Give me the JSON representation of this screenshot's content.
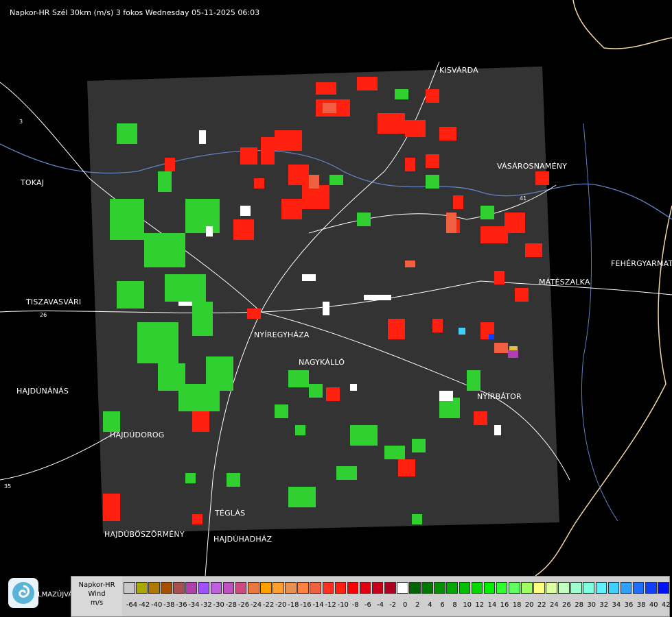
{
  "header": {
    "title": "Napkor-HR Szél 30km (m/s) 3 fokos Wednesday 05-11-2025 06:03"
  },
  "cities": [
    {
      "name": "KISVÁRDA"
    },
    {
      "name": "TOKAJ"
    },
    {
      "name": "VÁSÁROSNAMÉNY"
    },
    {
      "name": "FEHÉRGYARMAT"
    },
    {
      "name": "MÁTÉSZALKA"
    },
    {
      "name": "TISZAVASVÁRI"
    },
    {
      "name": "NYÍREGYHÁZA"
    },
    {
      "name": "NAGYKÁLLÓ"
    },
    {
      "name": "HAJDÚNÁNÁS"
    },
    {
      "name": "NYÍRBÁTOR"
    },
    {
      "name": "HAJDÚDOROG"
    },
    {
      "name": "TÉGLÁS"
    },
    {
      "name": "HAJDÚBÖSZÖRMÉNY"
    },
    {
      "name": "HAJDÚHADHÁZ"
    }
  ],
  "road_numbers": [
    "3",
    "26",
    "35",
    "41"
  ],
  "legend": {
    "title_line1": "Napkor-HR",
    "title_line2": "Wind",
    "title_line3": "m/s",
    "colors": [
      "#c8c8c8",
      "#a8a800",
      "#b07800",
      "#a85000",
      "#a85050",
      "#b040b0",
      "#a050ff",
      "#c060e0",
      "#c050c0",
      "#d04880",
      "#e87840",
      "#ffa000",
      "#ffa030",
      "#e89050",
      "#ff8040",
      "#f06040",
      "#ff3020",
      "#ff2010",
      "#ff0000",
      "#e00010",
      "#c80018",
      "#b00020",
      "#ffffff",
      "#006400",
      "#007800",
      "#009000",
      "#00a800",
      "#00c000",
      "#00d800",
      "#00f000",
      "#30ff30",
      "#60ff60",
      "#a0ff60",
      "#ffff80",
      "#e0ffa0",
      "#c0ffc0",
      "#a0ffd0",
      "#80ffe0",
      "#60f0ff",
      "#40d0ff",
      "#30a0ff",
      "#2070ff",
      "#1040ff",
      "#0010ff"
    ],
    "ticks": [
      "-64",
      "-42",
      "-40",
      "-38",
      "-36",
      "-34",
      "-32",
      "-30",
      "-28",
      "-26",
      "-24",
      "-22",
      "-20",
      "-18",
      "-16",
      "-14",
      "-12",
      "-10",
      "-8",
      "-6",
      "-4",
      "-2",
      "0",
      "2",
      "4",
      "6",
      "8",
      "10",
      "12",
      "14",
      "16",
      "18",
      "20",
      "22",
      "24",
      "26",
      "28",
      "30",
      "32",
      "34",
      "36",
      "38",
      "40",
      "42"
    ]
  },
  "logo": {
    "text": "LMAZÚJVÁR"
  },
  "colors": {
    "radar_bg": "#333333",
    "map_bg": "#000000",
    "border": "#f0d8a0",
    "river": "#6080c0"
  }
}
